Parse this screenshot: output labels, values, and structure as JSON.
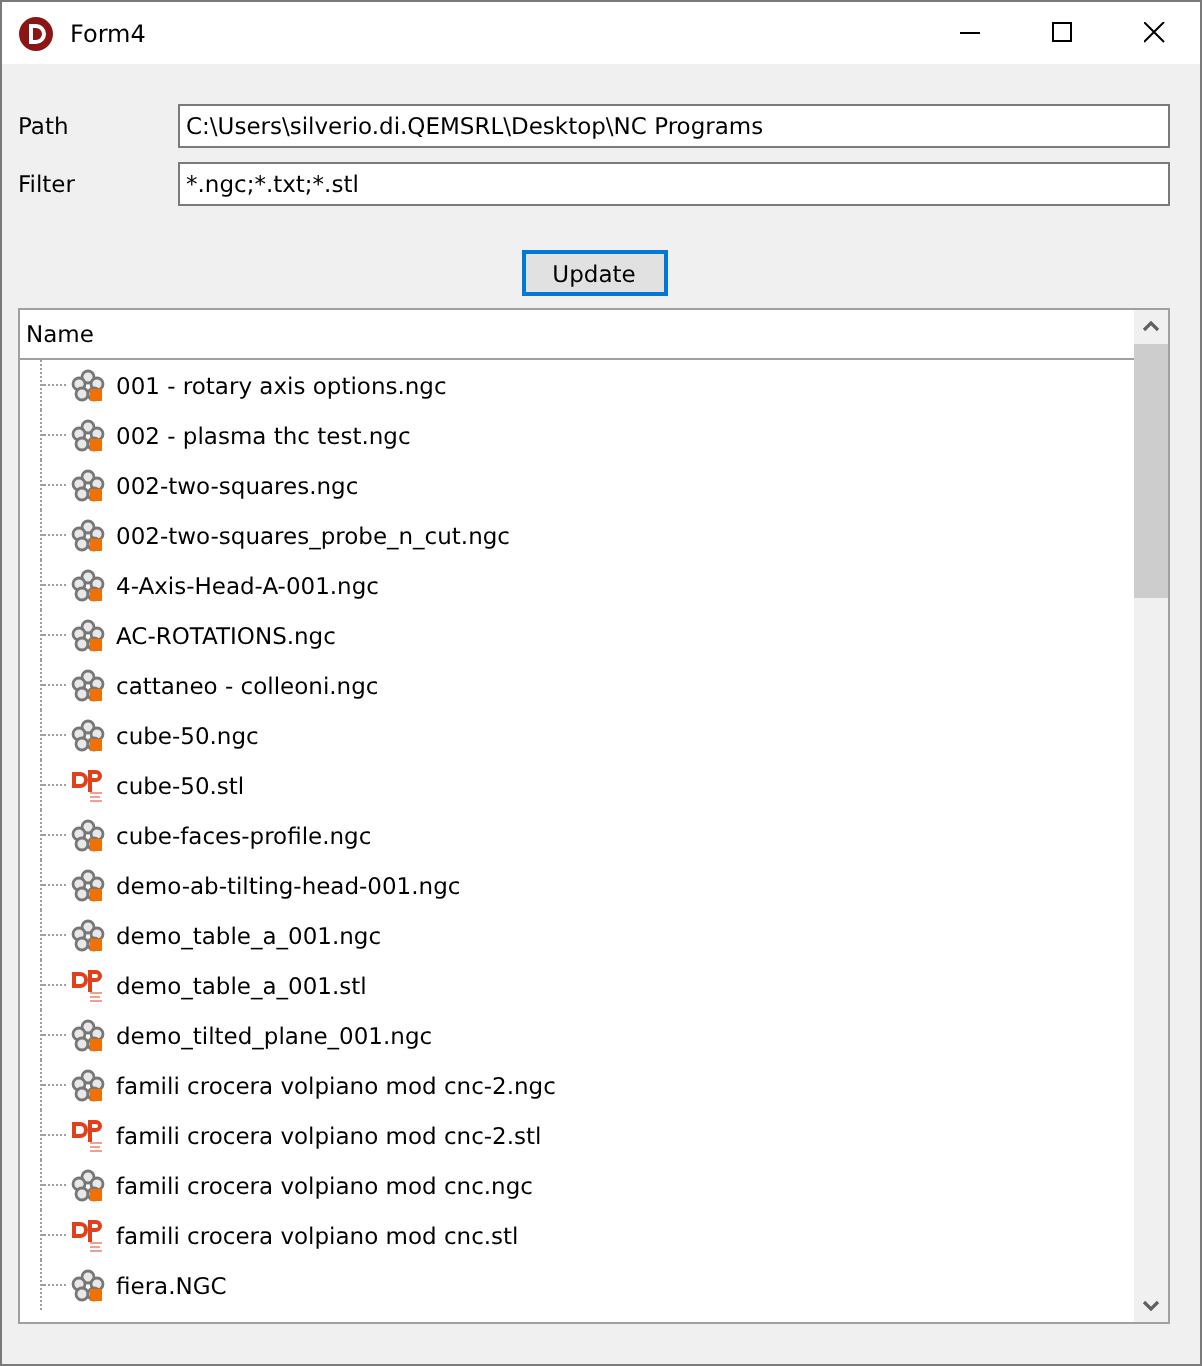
{
  "window": {
    "title": "Form4"
  },
  "path": {
    "label": "Path",
    "value": "C:\\Users\\silverio.di.QEMSRL\\Desktop\\NC Programs"
  },
  "filter": {
    "label": "Filter",
    "value": "*.ngc;*.txt;*.stl"
  },
  "update_button": "Update",
  "tree": {
    "column": "Name",
    "items": [
      {
        "name": "001 - rotary axis options.ngc",
        "kind": "ngc"
      },
      {
        "name": "002 - plasma thc test.ngc",
        "kind": "ngc"
      },
      {
        "name": "002-two-squares.ngc",
        "kind": "ngc"
      },
      {
        "name": "002-two-squares_probe_n_cut.ngc",
        "kind": "ngc"
      },
      {
        "name": "4-Axis-Head-A-001.ngc",
        "kind": "ngc"
      },
      {
        "name": "AC-ROTATIONS.ngc",
        "kind": "ngc"
      },
      {
        "name": "cattaneo  - colleoni.ngc",
        "kind": "ngc"
      },
      {
        "name": "cube-50.ngc",
        "kind": "ngc"
      },
      {
        "name": "cube-50.stl",
        "kind": "stl"
      },
      {
        "name": "cube-faces-profile.ngc",
        "kind": "ngc"
      },
      {
        "name": "demo-ab-tilting-head-001.ngc",
        "kind": "ngc"
      },
      {
        "name": "demo_table_a_001.ngc",
        "kind": "ngc"
      },
      {
        "name": "demo_table_a_001.stl",
        "kind": "stl"
      },
      {
        "name": "demo_tilted_plane_001.ngc",
        "kind": "ngc"
      },
      {
        "name": "famili crocera volpiano mod cnc-2.ngc",
        "kind": "ngc"
      },
      {
        "name": "famili crocera volpiano mod cnc-2.stl",
        "kind": "stl"
      },
      {
        "name": "famili crocera volpiano mod cnc.ngc",
        "kind": "ngc"
      },
      {
        "name": "famili crocera volpiano mod cnc.stl",
        "kind": "stl"
      },
      {
        "name": "fiera.NGC",
        "kind": "ngc"
      }
    ]
  }
}
